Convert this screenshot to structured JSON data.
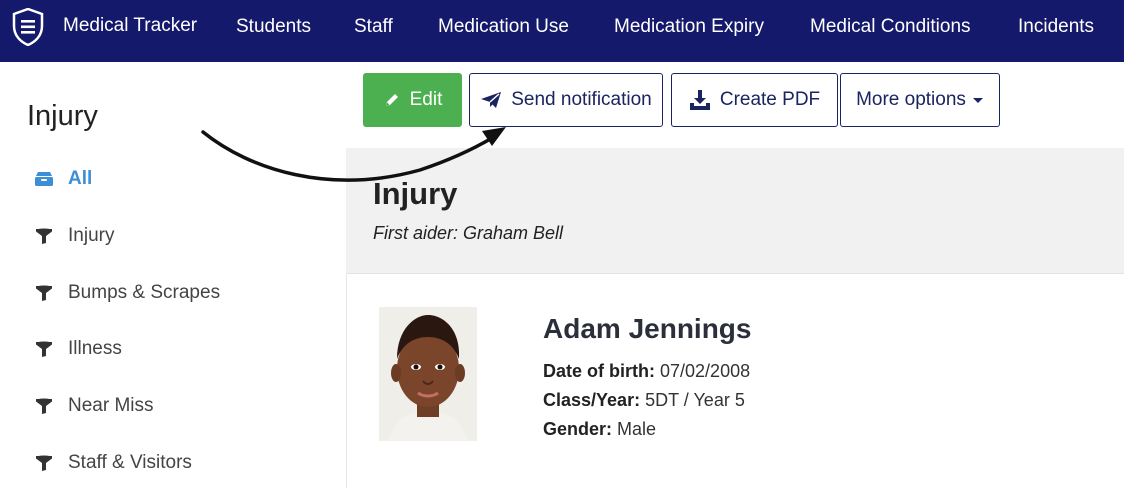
{
  "app": {
    "brand": "Medical Tracker",
    "logo_icon": "shield-icon"
  },
  "nav": {
    "items": [
      {
        "label": "Students"
      },
      {
        "label": "Staff"
      },
      {
        "label": "Medication Use"
      },
      {
        "label": "Medication Expiry"
      },
      {
        "label": "Medical Conditions"
      },
      {
        "label": "Incidents"
      }
    ]
  },
  "sidebar": {
    "title": "Injury",
    "items": [
      {
        "label": "All",
        "icon": "inbox-icon",
        "active": true
      },
      {
        "label": "Injury",
        "icon": "filter-icon"
      },
      {
        "label": "Bumps & Scrapes",
        "icon": "filter-icon"
      },
      {
        "label": "Illness",
        "icon": "filter-icon"
      },
      {
        "label": "Near Miss",
        "icon": "filter-icon"
      },
      {
        "label": "Staff & Visitors",
        "icon": "filter-icon"
      }
    ]
  },
  "toolbar": {
    "edit_label": "Edit",
    "send_label": "Send notification",
    "pdf_label": "Create PDF",
    "more_label": "More options"
  },
  "record": {
    "title": "Injury",
    "first_aider": "First aider: Graham Bell"
  },
  "student": {
    "name": "Adam Jennings",
    "dob_label": "Date of birth:",
    "dob_value": "07/02/2008",
    "class_label": "Class/Year:",
    "class_value": "5DT / Year 5",
    "gender_label": "Gender:",
    "gender_value": "Male"
  },
  "colors": {
    "nav_bg": "#14196b",
    "accent_blue": "#3c8fd6",
    "edit_green": "#4caf50",
    "button_border": "#1a2461"
  }
}
